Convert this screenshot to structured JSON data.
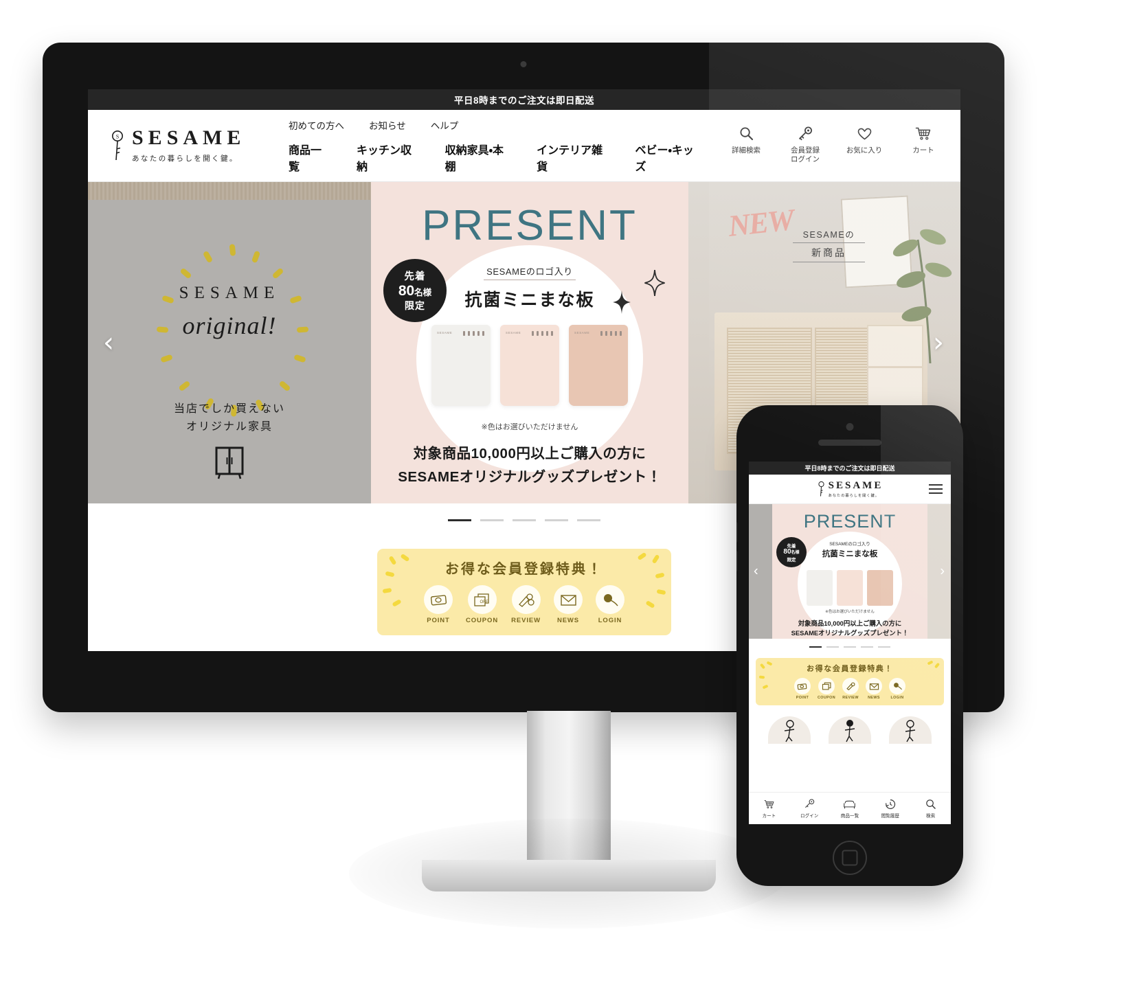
{
  "site": {
    "announcement": "平日8時までのご注文は即日配送",
    "brand_name": "SESAME",
    "brand_tagline": "あなたの暮らしを開く鍵。",
    "brand_icon": "key-icon"
  },
  "nav": {
    "secondary": [
      {
        "label": "初めての方へ"
      },
      {
        "label": "お知らせ"
      },
      {
        "label": "ヘルプ"
      }
    ],
    "primary": [
      {
        "label": "商品一覧"
      },
      {
        "label": "キッチン収納"
      },
      {
        "label": "収納家具・本棚"
      },
      {
        "label": "インテリア雑貨"
      },
      {
        "label": "ベビー・キッズ"
      }
    ],
    "utilities": [
      {
        "icon": "search-icon",
        "label": "詳細検索"
      },
      {
        "icon": "key-icon",
        "label": "会員登録\nログイン"
      },
      {
        "icon": "heart-icon",
        "label": "お気に入り"
      },
      {
        "icon": "cart-icon",
        "label": "カート"
      }
    ]
  },
  "hero": {
    "slides": [
      {
        "id": "sesame-original",
        "title": "SESAME",
        "script": "original!",
        "caption_line1": "当店でしか買えない",
        "caption_line2": "オリジナル家具",
        "icon": "cabinet-icon",
        "bg_color": "#b2b0ad"
      },
      {
        "id": "present",
        "headline": "PRESENT",
        "badge_line1": "先着",
        "badge_number": "80",
        "badge_unit": "名様",
        "badge_line3": "限定",
        "gift_sub": "SESAMEのロゴ入り",
        "gift_name": "抗菌ミニまな板",
        "note": "※色はお選びいただけません",
        "cta_line1": "対象商品10,000円以上ご購入の方に",
        "cta_line2": "SESAMEオリジナルグッズプレゼント！",
        "bg_color": "#f4e2dc",
        "headline_color": "#3f7582",
        "board_colors": [
          "#f1f0ed",
          "#f6e1d7",
          "#e8c6b3"
        ]
      },
      {
        "id": "new-products",
        "badge": "NEW",
        "sub_line1": "SESAMEの",
        "sub_line2": "新商品",
        "bg_color": "#ded8d0",
        "badge_color": "#e7a9a0"
      }
    ],
    "prev_arrow": "‹",
    "next_arrow": "›",
    "pagination": [
      {
        "active": true
      },
      {
        "active": false
      },
      {
        "active": false
      },
      {
        "active": false
      },
      {
        "active": false
      }
    ]
  },
  "benefits": {
    "title": "お得な会員登録特典！",
    "bg_color": "#fbeaa8",
    "items": [
      {
        "icon": "money-icon",
        "label": "POINT"
      },
      {
        "icon": "coupon-icon",
        "label": "COUPON"
      },
      {
        "icon": "review-pen-icon",
        "label": "REVIEW"
      },
      {
        "icon": "mail-icon",
        "label": "NEWS"
      },
      {
        "icon": "login-key-icon",
        "label": "LOGIN"
      }
    ]
  },
  "mobile": {
    "announcement": "平日8時までのご注文は即日配送",
    "brand_name": "SESAME",
    "brand_tagline": "あなたの暮らしを開く鍵。",
    "menu_icon": "hamburger-icon",
    "hero": {
      "headline": "PRESENT",
      "badge_line1": "先着",
      "badge_number": "80",
      "badge_unit": "名様",
      "badge_line3": "限定",
      "gift_sub": "SESAMEのロゴ入り",
      "gift_name": "抗菌ミニまな板",
      "note": "※色はお選びいただけません",
      "cta_line1": "対象商品10,000円以上ご購入の方に",
      "cta_line2": "SESAMEオリジナルグッズプレゼント！",
      "prev_arrow": "‹",
      "next_arrow": "›"
    },
    "benefits": {
      "title": "お得な会員登録特典！",
      "items": [
        {
          "icon": "money-icon",
          "label": "POINT"
        },
        {
          "icon": "coupon-icon",
          "label": "COUPON"
        },
        {
          "icon": "review-pen-icon",
          "label": "REVIEW"
        },
        {
          "icon": "mail-icon",
          "label": "NEWS"
        },
        {
          "icon": "login-key-icon",
          "label": "LOGIN"
        }
      ]
    },
    "tabbar": [
      {
        "icon": "cart-icon",
        "label": "カート"
      },
      {
        "icon": "key-icon",
        "label": "ログイン"
      },
      {
        "icon": "sofa-icon",
        "label": "商品一覧"
      },
      {
        "icon": "history-icon",
        "label": "閲覧履歴"
      },
      {
        "icon": "search-icon",
        "label": "検索"
      }
    ]
  }
}
